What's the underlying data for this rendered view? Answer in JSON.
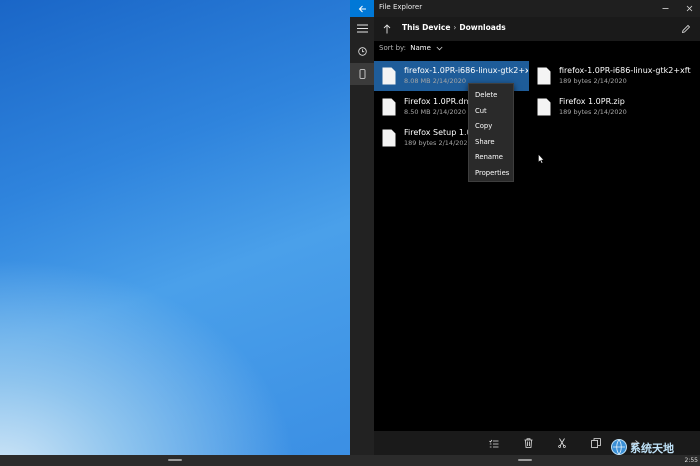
{
  "window": {
    "title": "File Explorer"
  },
  "breadcrumb": {
    "root": "This Device",
    "separator": "›",
    "current": "Downloads"
  },
  "sort": {
    "label": "Sort by:",
    "value": "Name"
  },
  "files": [
    {
      "name": "firefox-1.0PR-i686-linux-gtk2+xft",
      "size": "8.08 MB",
      "date": "2/14/2020",
      "selected": true
    },
    {
      "name": "firefox-1.0PR-i686-linux-gtk2+xft",
      "size": "189 bytes",
      "date": "2/14/2020",
      "selected": false
    },
    {
      "name": "Firefox 1.0PR.dmg",
      "size": "8.50 MB",
      "date": "2/14/2020",
      "selected": false
    },
    {
      "name": "Firefox 1.0PR.zip",
      "size": "189 bytes",
      "date": "2/14/2020",
      "selected": false
    },
    {
      "name": "Firefox Setup 1.0",
      "size": "189 bytes",
      "date": "2/14/2020",
      "selected": false
    }
  ],
  "context_menu": {
    "items": [
      "Delete",
      "Cut",
      "Copy",
      "Share",
      "Rename",
      "Properties"
    ]
  },
  "icons": {
    "back": "back-arrow-icon",
    "menu": "hamburger-icon",
    "recent": "clock-icon",
    "device": "phone-icon",
    "up": "up-arrow-icon",
    "edit": "pencil-icon",
    "select": "select-list-icon",
    "delete": "trash-icon",
    "cut": "scissors-icon",
    "copy": "copy-icon",
    "share": "share-icon"
  },
  "colors": {
    "accent": "#0078d7",
    "selection": "#1e5c99"
  },
  "system": {
    "clock": "2:55"
  },
  "watermark": {
    "text": "系统天地"
  }
}
